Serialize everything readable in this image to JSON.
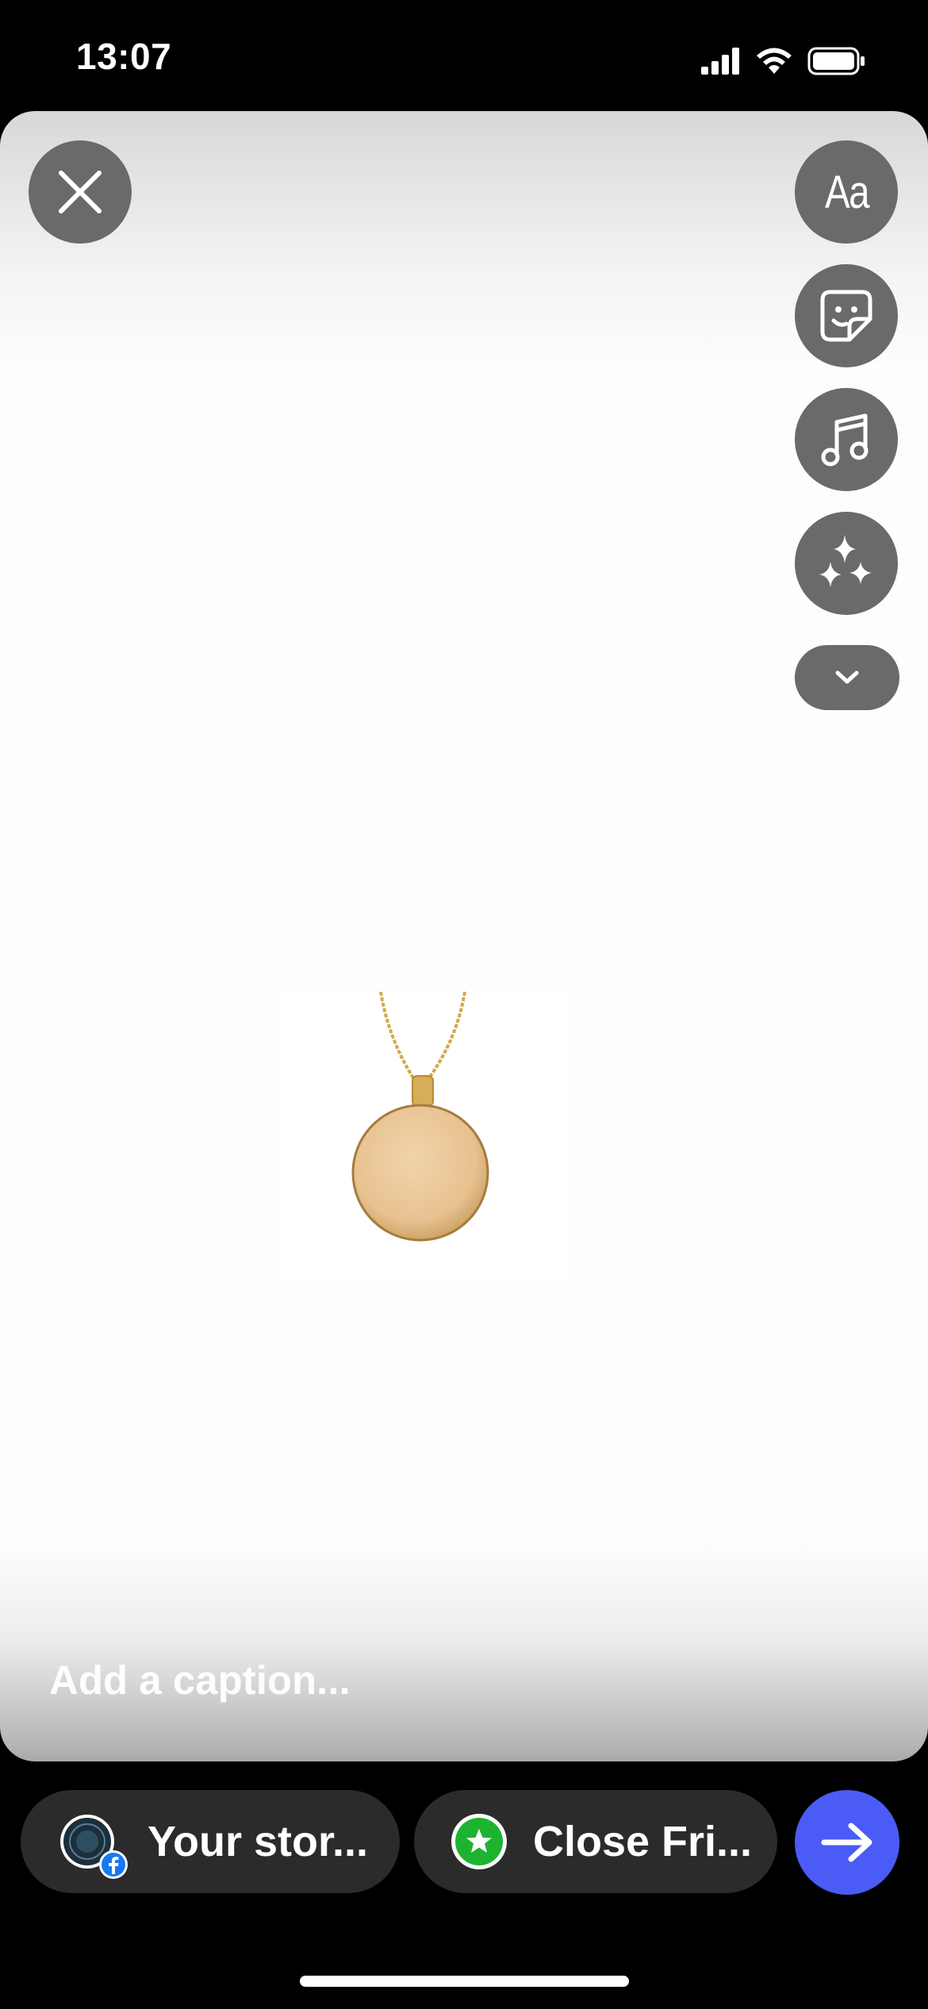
{
  "status_bar": {
    "time": "13:07"
  },
  "editor": {
    "close_icon": "close-icon",
    "tools": [
      {
        "name": "text-tool",
        "label": "Aa"
      },
      {
        "name": "sticker-tool",
        "icon": "sticker-icon"
      },
      {
        "name": "music-tool",
        "icon": "music-note-icon"
      },
      {
        "name": "effects-tool",
        "icon": "sparkles-icon"
      },
      {
        "name": "more-tools",
        "icon": "chevron-down-icon"
      }
    ],
    "caption_placeholder": "Add a caption...",
    "product": {
      "description_icon": "gold-pendant-necklace-image",
      "colors": {
        "chain": "#d4a84a",
        "pendant": "#ecc99a"
      }
    }
  },
  "share_bar": {
    "your_story_label": "Your stor...",
    "close_friends_label": "Close Fri...",
    "send_icon": "arrow-right-icon"
  },
  "colors": {
    "send_button": "#4a5cf5",
    "close_friends_green": "#1db32f",
    "pill_background": "#2b2b2b",
    "tool_button": "#6a6a6a",
    "facebook_blue": "#1877f2"
  }
}
